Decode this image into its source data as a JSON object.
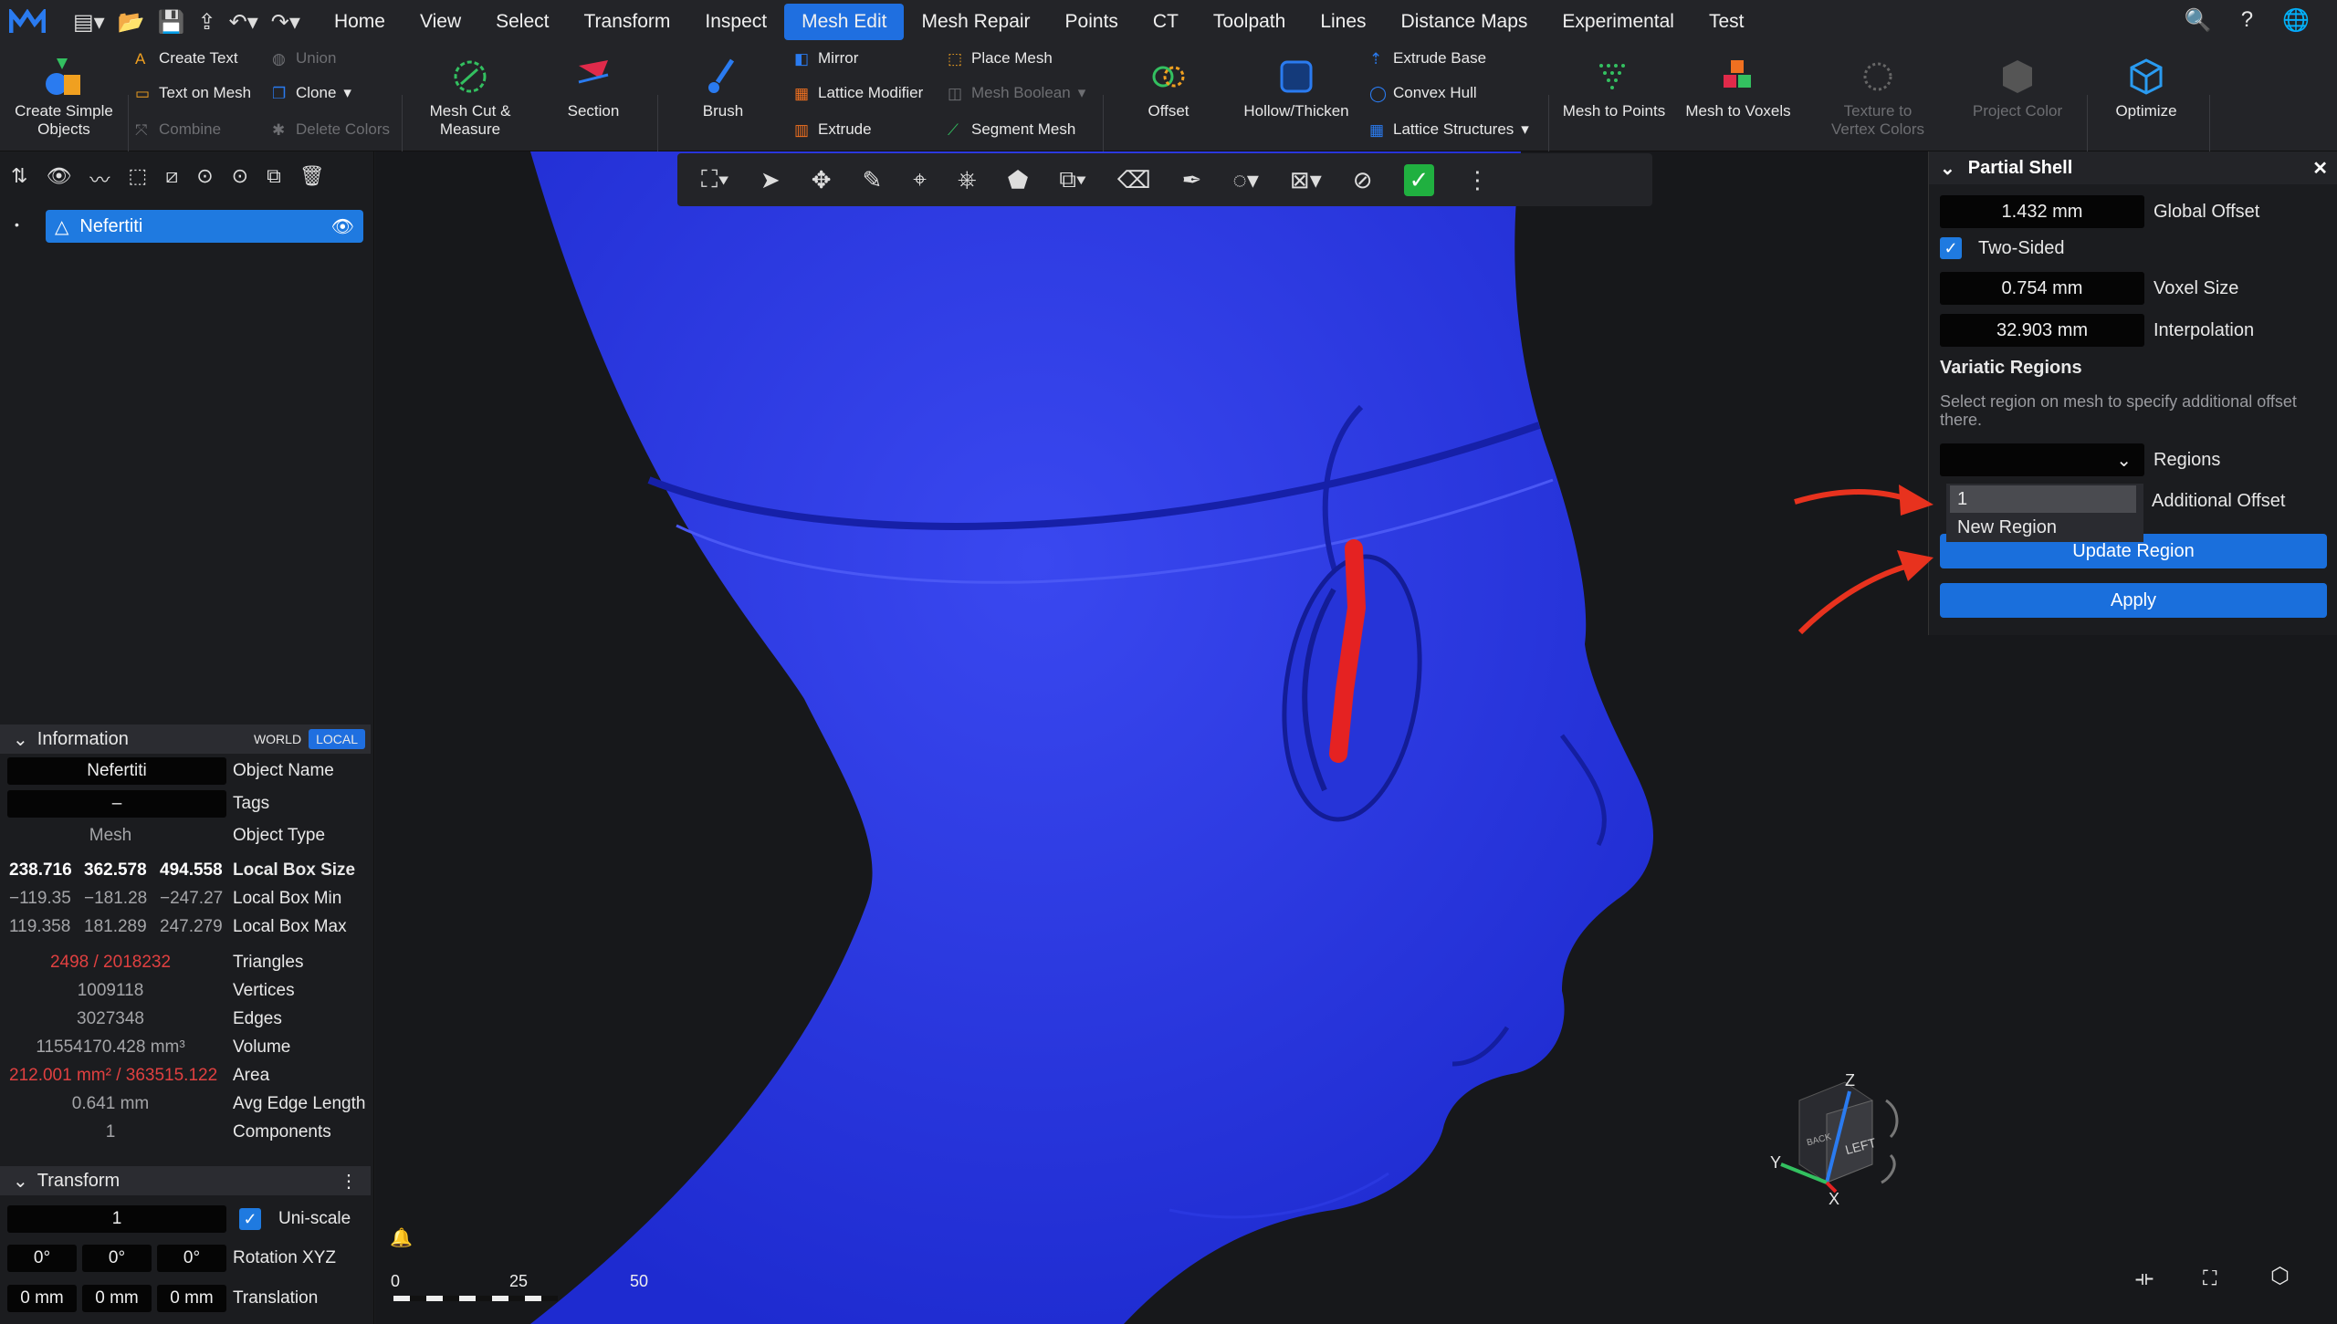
{
  "menu": [
    "Home",
    "View",
    "Select",
    "Transform",
    "Inspect",
    "Mesh Edit",
    "Mesh Repair",
    "Points",
    "CT",
    "Toolpath",
    "Lines",
    "Distance Maps",
    "Experimental",
    "Test"
  ],
  "menu_active": "Mesh Edit",
  "ribbon": {
    "create_simple_objects": "Create Simple Objects",
    "create_text": "Create Text",
    "text_on_mesh": "Text on Mesh",
    "combine": "Combine",
    "union": "Union",
    "clone": "Clone",
    "delete_colors": "Delete Colors",
    "mesh_cut": "Mesh Cut & Measure",
    "section": "Section",
    "brush": "Brush",
    "mirror": "Mirror",
    "lattice_modifier": "Lattice Modifier",
    "extrude": "Extrude",
    "place_mesh": "Place Mesh",
    "mesh_boolean": "Mesh Boolean",
    "segment_mesh": "Segment Mesh",
    "offset": "Offset",
    "hollow_thicken": "Hollow/Thicken",
    "extrude_base": "Extrude Base",
    "convex_hull": "Convex Hull",
    "lattice_structures": "Lattice Structures",
    "mesh_to_points": "Mesh to Points",
    "mesh_to_voxels": "Mesh to Voxels",
    "texture_to_vertex": "Texture to Vertex Colors",
    "project_color": "Project Color",
    "optimize": "Optimize"
  },
  "scene": {
    "object_name": "Nefertiti"
  },
  "info": {
    "title": "Information",
    "world": "WORLD",
    "local": "LOCAL",
    "object_name": "Nefertiti",
    "object_name_label": "Object Name",
    "tags": "–",
    "tags_label": "Tags",
    "object_type": "Mesh",
    "object_type_label": "Object Type",
    "box_size": [
      "238.716",
      "362.578",
      "494.558"
    ],
    "box_size_label": "Local Box Size",
    "box_min": [
      "−119.35",
      "−181.28",
      "−247.27"
    ],
    "box_min_label": "Local Box Min",
    "box_max": [
      "119.358",
      "181.289",
      "247.279"
    ],
    "box_max_label": "Local Box Max",
    "triangles": "2498 / 2018232",
    "triangles_label": "Triangles",
    "vertices": "1009118",
    "vertices_label": "Vertices",
    "edges": "3027348",
    "edges_label": "Edges",
    "volume": "11554170.428 mm³",
    "volume_label": "Volume",
    "area": "212.001 mm² / 363515.122",
    "area_label": "Area",
    "avg_edge": "0.641 mm",
    "avg_edge_label": "Avg Edge Length",
    "components": "1",
    "components_label": "Components"
  },
  "transform": {
    "title": "Transform",
    "scale": "1",
    "uniscale": "Uni-scale",
    "rot": [
      "0°",
      "0°",
      "0°"
    ],
    "rot_label": "Rotation XYZ",
    "trans": [
      "0 mm",
      "0 mm",
      "0 mm"
    ],
    "trans_label": "Translation"
  },
  "panel": {
    "title": "Partial Shell",
    "global_offset": "1.432 mm",
    "global_offset_label": "Global Offset",
    "two_sided": "Two-Sided",
    "voxel_size": "0.754 mm",
    "voxel_size_label": "Voxel Size",
    "interpolation": "32.903 mm",
    "interpolation_label": "Interpolation",
    "variatic": "Variatic Regions",
    "hint": "Select region on mesh to specify additional offset there.",
    "regions_label": "Regions",
    "additional_offset": "Additional Offset",
    "update_region": "Update Region",
    "apply": "Apply",
    "dropdown_items": [
      "1",
      "New Region"
    ]
  },
  "scale_bar": [
    "0",
    "25",
    "50"
  ],
  "axes": {
    "z": "Z",
    "y": "Y",
    "x": "X",
    "face": "LEFT",
    "back": "BACK"
  },
  "colors": {
    "accent": "#1f6fe0",
    "mesh": "#2a37e8",
    "highlight": "#e52222"
  }
}
